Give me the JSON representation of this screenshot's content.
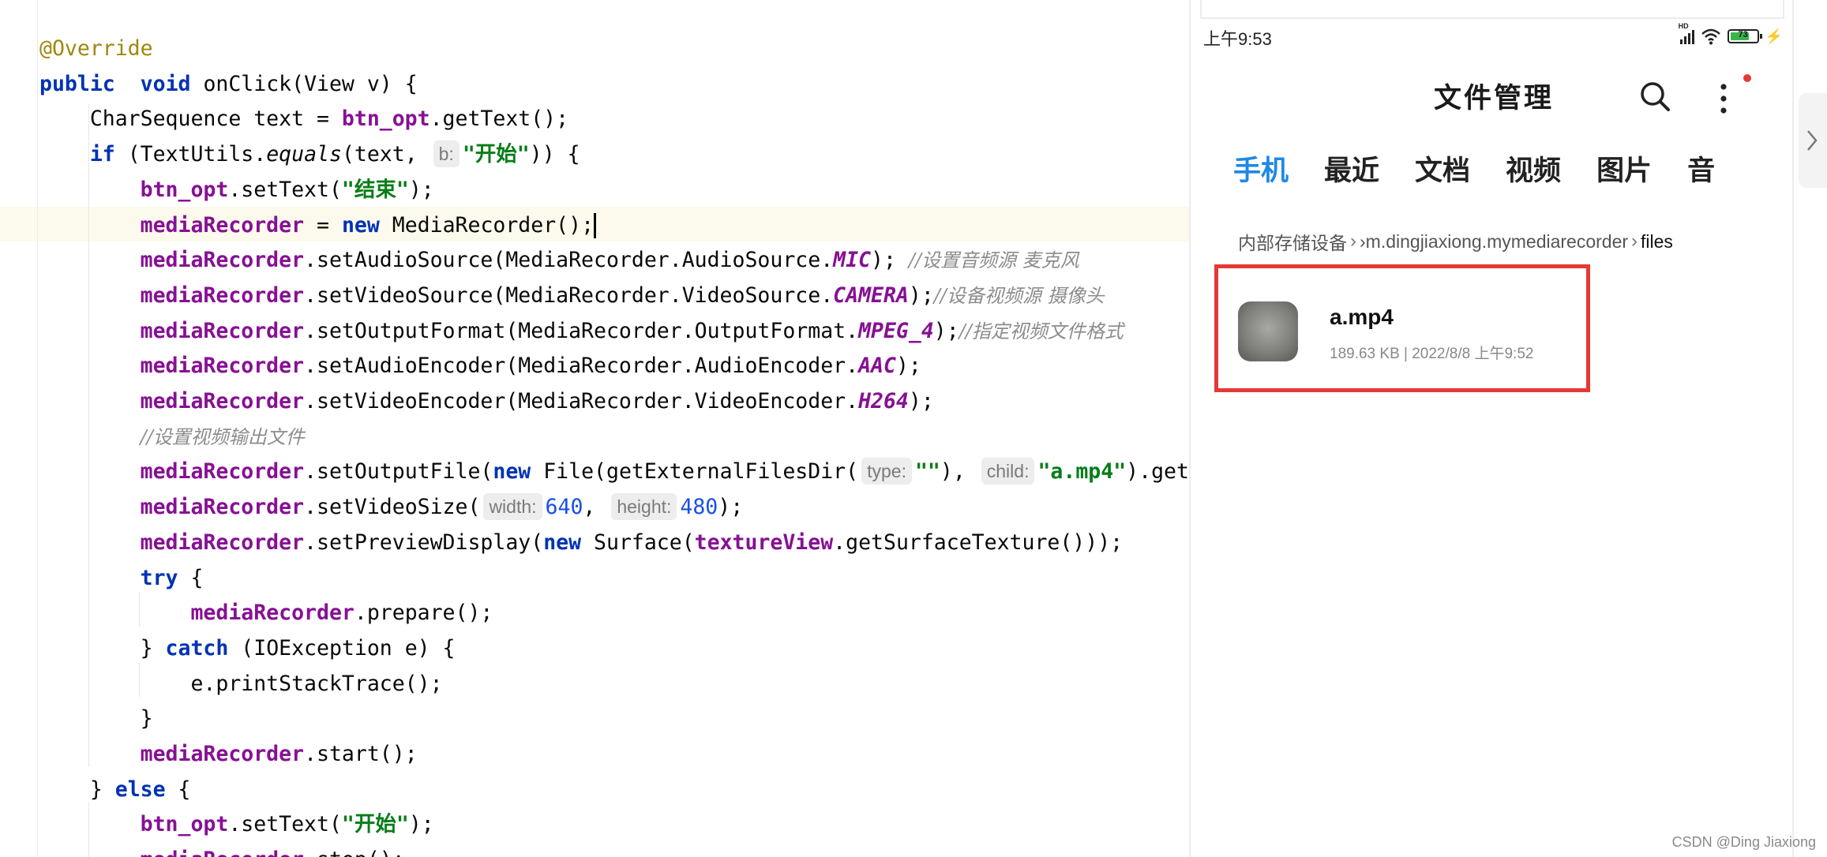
{
  "editor": {
    "lines": [
      [
        [
          "ann",
          "@Override"
        ]
      ],
      [
        [
          "kw",
          "public"
        ],
        [
          "",
          "  "
        ],
        [
          "kw",
          "void"
        ],
        [
          "",
          " onClick(View v) {"
        ]
      ],
      [
        [
          "",
          "    CharSequence text = "
        ],
        [
          "fld",
          "btn_opt"
        ],
        [
          "",
          ".getText();"
        ]
      ],
      [
        [
          "",
          "    "
        ],
        [
          "kw",
          "if"
        ],
        [
          "",
          " (TextUtils."
        ],
        [
          "ita",
          "equals"
        ],
        [
          "",
          "(text, "
        ],
        [
          "hint",
          "b:"
        ],
        [
          "str",
          "\"开始\""
        ],
        [
          "",
          "))"
        ],
        [
          "",
          " {"
        ]
      ],
      [
        [
          "",
          "        "
        ],
        [
          "fld",
          "btn_opt"
        ],
        [
          "",
          ".setText("
        ],
        [
          "str",
          "\"结束\""
        ],
        [
          "",
          ");"
        ]
      ],
      [
        [
          "",
          "        "
        ],
        [
          "fld",
          "mediaRecorder"
        ],
        [
          "",
          " = "
        ],
        [
          "kw",
          "new"
        ],
        [
          "",
          " MediaRecorder();"
        ],
        [
          "caret",
          ""
        ]
      ],
      [
        [
          "",
          "        "
        ],
        [
          "fld",
          "mediaRecorder"
        ],
        [
          "",
          ".setAudioSource(MediaRecorder.AudioSource."
        ],
        [
          "cst",
          "MIC"
        ],
        [
          "",
          "); "
        ],
        [
          "cmt",
          "//设置音频源 麦克风"
        ]
      ],
      [
        [
          "",
          "        "
        ],
        [
          "fld",
          "mediaRecorder"
        ],
        [
          "",
          ".setVideoSource(MediaRecorder.VideoSource."
        ],
        [
          "cst",
          "CAMERA"
        ],
        [
          "",
          ");"
        ],
        [
          "cmt",
          "//设备视频源 摄像头"
        ]
      ],
      [
        [
          "",
          "        "
        ],
        [
          "fld",
          "mediaRecorder"
        ],
        [
          "",
          ".setOutputFormat(MediaRecorder.OutputFormat."
        ],
        [
          "cst",
          "MPEG_4"
        ],
        [
          "",
          ");"
        ],
        [
          "cmt",
          "//指定视频文件格式"
        ]
      ],
      [
        [
          "",
          "        "
        ],
        [
          "fld",
          "mediaRecorder"
        ],
        [
          "",
          ".setAudioEncoder(MediaRecorder.AudioEncoder."
        ],
        [
          "cst",
          "AAC"
        ],
        [
          "",
          ");"
        ]
      ],
      [
        [
          "",
          "        "
        ],
        [
          "fld",
          "mediaRecorder"
        ],
        [
          "",
          ".setVideoEncoder(MediaRecorder.VideoEncoder."
        ],
        [
          "cst",
          "H264"
        ],
        [
          "",
          ");"
        ]
      ],
      [
        [
          "",
          "        "
        ],
        [
          "cmt",
          "//设置视频输出文件"
        ]
      ],
      [
        [
          "",
          "        "
        ],
        [
          "fld",
          "mediaRecorder"
        ],
        [
          "",
          ".setOutputFile("
        ],
        [
          "kw",
          "new"
        ],
        [
          "",
          " File(getExternalFilesDir("
        ],
        [
          "hint",
          "type:"
        ],
        [
          "str",
          "\"\""
        ],
        [
          "",
          "), "
        ],
        [
          "hint",
          "child:"
        ],
        [
          "str",
          "\"a.mp4\""
        ],
        [
          "",
          ").getAbsolutePath());"
        ]
      ],
      [
        [
          "",
          "        "
        ],
        [
          "fld",
          "mediaRecorder"
        ],
        [
          "",
          ".setVideoSize("
        ],
        [
          "hint",
          "width:"
        ],
        [
          "num",
          "640"
        ],
        [
          "",
          ", "
        ],
        [
          "hint",
          "height:"
        ],
        [
          "num",
          "480"
        ],
        [
          "",
          ");"
        ]
      ],
      [
        [
          "",
          "        "
        ],
        [
          "fld",
          "mediaRecorder"
        ],
        [
          "",
          ".setPreviewDisplay("
        ],
        [
          "kw",
          "new"
        ],
        [
          "",
          " Surface("
        ],
        [
          "fld",
          "textureView"
        ],
        [
          "",
          ".getSurfaceTexture()));"
        ]
      ],
      [
        [
          "",
          "        "
        ],
        [
          "kw",
          "try"
        ],
        [
          "",
          " {"
        ]
      ],
      [
        [
          "",
          "            "
        ],
        [
          "fld",
          "mediaRecorder"
        ],
        [
          "",
          ".prepare();"
        ]
      ],
      [
        [
          "",
          "        } "
        ],
        [
          "kw",
          "catch"
        ],
        [
          "",
          " (IOException e) {"
        ]
      ],
      [
        [
          "",
          "            e.printStackTrace();"
        ]
      ],
      [
        [
          "",
          "        }"
        ]
      ],
      [
        [
          "",
          "        "
        ],
        [
          "fld",
          "mediaRecorder"
        ],
        [
          "",
          ".start();"
        ]
      ],
      [
        [
          "",
          "    } "
        ],
        [
          "kw",
          "else"
        ],
        [
          "",
          " {"
        ]
      ],
      [
        [
          "",
          "        "
        ],
        [
          "fld",
          "btn_opt"
        ],
        [
          "",
          ".setText("
        ],
        [
          "str",
          "\"开始\""
        ],
        [
          "",
          ");"
        ]
      ],
      [
        [
          "",
          "        "
        ],
        [
          "fld",
          "mediaRecorder"
        ],
        [
          "",
          ".stop();"
        ]
      ]
    ]
  },
  "phone": {
    "status": {
      "time": "上午9:53",
      "signal_label": "HD",
      "battery": "73",
      "battery_level": 0.73
    },
    "title": "文件管理",
    "icons": {
      "search": "search-icon",
      "more": "more-vertical-icon"
    },
    "tabs": [
      "手机",
      "最近",
      "文档",
      "视频",
      "图片",
      "音"
    ],
    "active_tab": 0,
    "breadcrumb": [
      "内部存储设备",
      "›m.dingjiaxiong.mymediarecorder",
      "files"
    ],
    "file": {
      "name": "a.mp4",
      "meta": "189.63 KB  |  2022/8/8 上午9:52"
    }
  },
  "watermark": "CSDN @Ding Jiaxiong",
  "colors": {
    "keyword": "#0033b3",
    "field": "#871094",
    "string": "#067d17",
    "annotation": "#9e880d",
    "comment": "#8c8c8c",
    "active_tab": "#1e88e5",
    "highlight_box": "#e53935"
  }
}
